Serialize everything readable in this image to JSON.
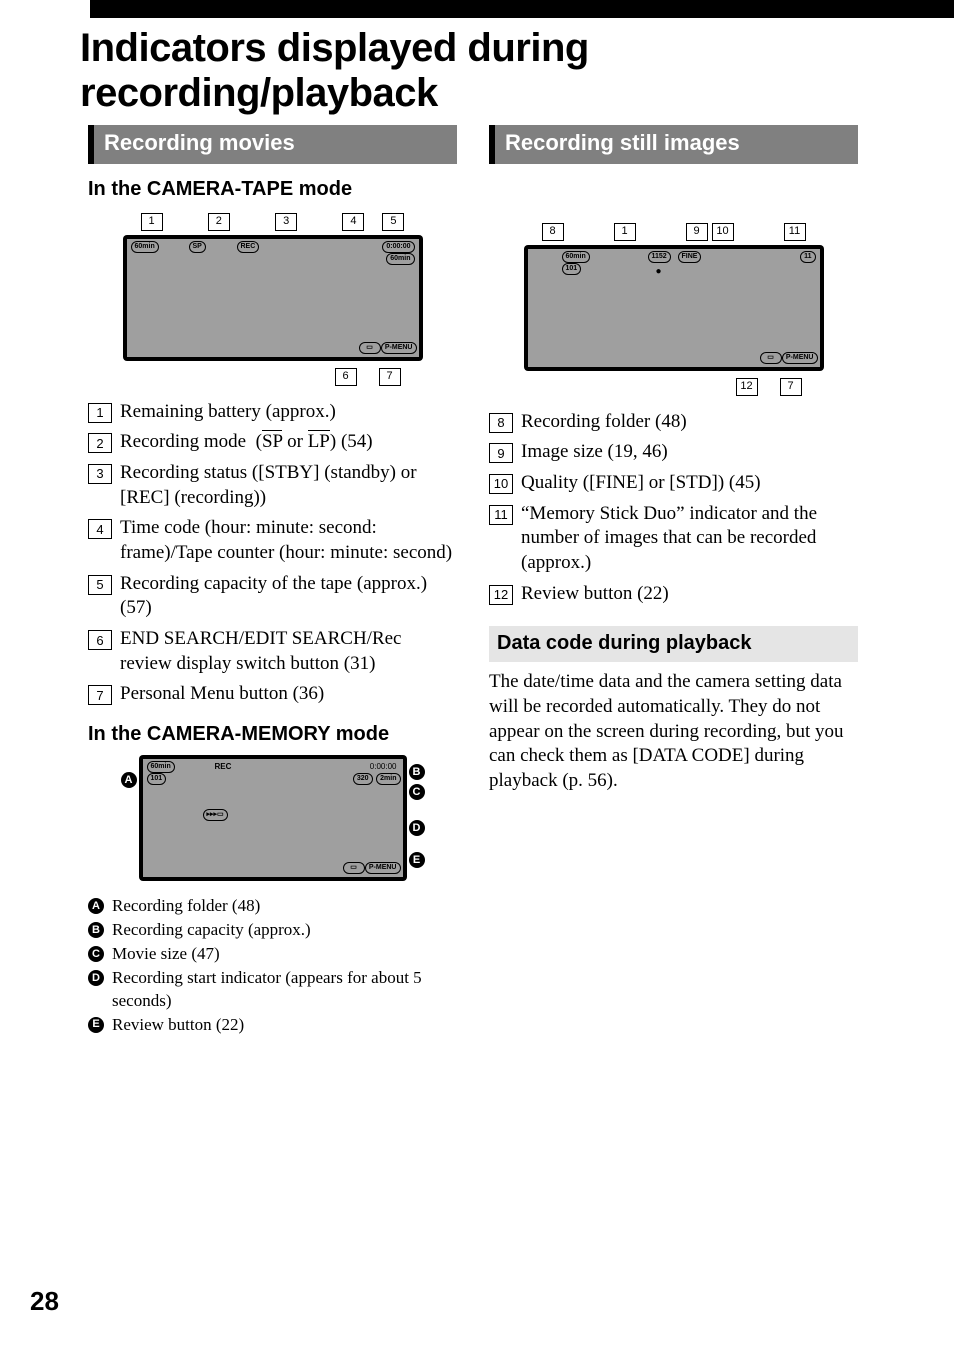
{
  "page_title": "Indicators displayed during recording/playback",
  "page_number": "28",
  "left": {
    "section_head": "Recording movies",
    "sub1": "In the CAMERA-TAPE mode",
    "diagram1": {
      "callouts": [
        "1",
        "2",
        "3",
        "4",
        "5",
        "6",
        "7"
      ],
      "batt": "60min",
      "sp": "SP",
      "rec": "REC",
      "timecode": "0:00:00",
      "tape": "60min",
      "pmenu": "P-MENU"
    },
    "items_num": [
      "Remaining battery (approx.)",
      "Recording mode  (SP or LP) (54)",
      "Recording status ([STBY] (standby) or [REC] (recording))",
      "Time code (hour: minute: second: frame)/Tape counter (hour: minute: second)",
      "Recording capacity of the tape (approx.) (57)",
      "END SEARCH/EDIT SEARCH/Rec review display switch button (31)",
      "Personal Menu button (36)"
    ],
    "sub2": "In the CAMERA-MEMORY mode",
    "diagram2": {
      "letters": [
        "A",
        "B",
        "C",
        "D",
        "E"
      ],
      "batt": "60min",
      "folder": "101",
      "rec": "REC",
      "timecode": "0:00:00",
      "size": "320",
      "cap": "2min",
      "pmenu": "P-MENU"
    },
    "items_letters": [
      "Recording folder (48)",
      "Recording capacity (approx.)",
      "Movie size (47)",
      "Recording start indicator (appears for about 5 seconds)",
      "Review button (22)"
    ]
  },
  "right": {
    "section_head": "Recording still images",
    "diagram": {
      "callouts": [
        "8",
        "1",
        "9",
        "10",
        "11",
        "12",
        "7"
      ],
      "batt": "60min",
      "folder": "101",
      "size": "1152",
      "fine": "FINE",
      "count": "11",
      "pmenu": "P-MENU"
    },
    "items_num_start": 8,
    "items_num": [
      "Recording folder (48)",
      "Image size (19, 46)",
      "Quality ([FINE] or [STD]) (45)",
      "“Memory Stick Duo” indicator and the number of images that can be recorded (approx.)",
      "Review button (22)"
    ],
    "sub_head": "Data code during playback",
    "paragraph": "The date/time data and the camera setting data will be recorded automatically. They do not appear on the screen during recording, but you can check them as [DATA CODE] during playback (p. 56)."
  }
}
